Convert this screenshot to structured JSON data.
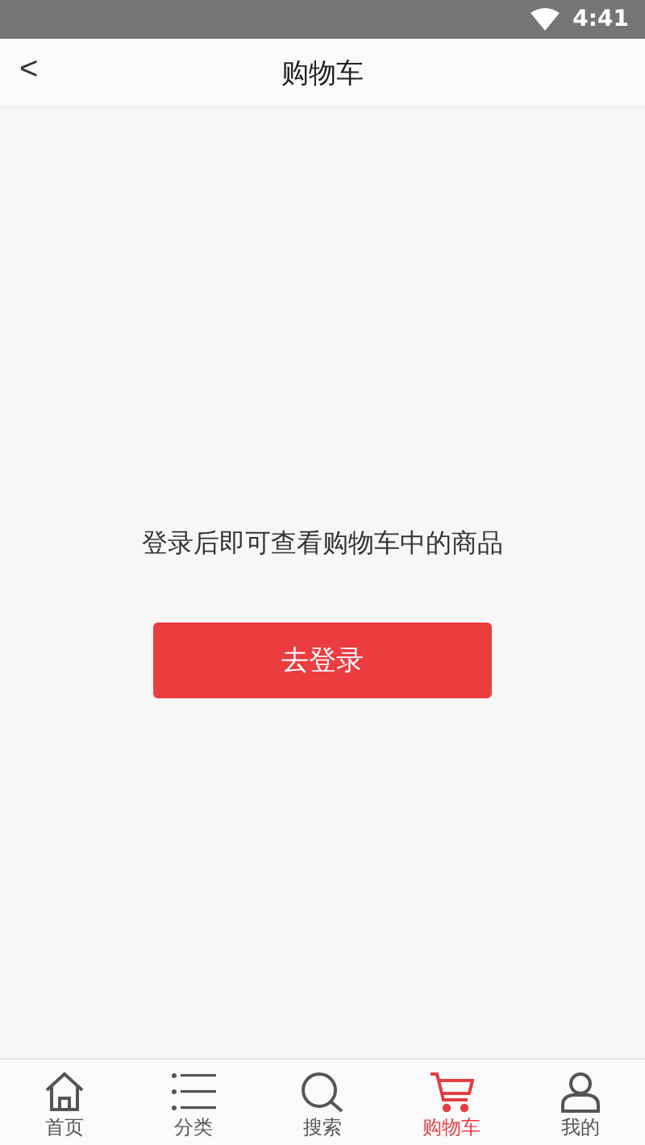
{
  "status_bar": {
    "time": "4:41"
  },
  "header": {
    "back": "<",
    "title": "购物车"
  },
  "empty_state": {
    "message": "登录后即可查看购物车中的商品",
    "button": "去登录"
  },
  "tabs": [
    {
      "kind": "home",
      "label": "首页",
      "selected": false
    },
    {
      "kind": "category",
      "label": "分类",
      "selected": false
    },
    {
      "kind": "search",
      "label": "搜索",
      "selected": false
    },
    {
      "kind": "cart",
      "label": "购物车",
      "selected": true
    },
    {
      "kind": "profile",
      "label": "我的",
      "selected": false
    }
  ]
}
